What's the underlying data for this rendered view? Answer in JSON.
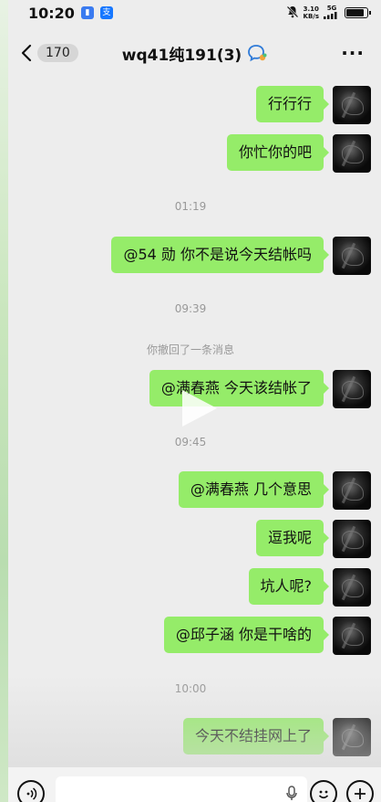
{
  "status_bar": {
    "time": "10:20",
    "net_speed_value": "3.10",
    "net_speed_unit": "KB/s",
    "network": "5G",
    "battery_level": 0.85
  },
  "header": {
    "back_count": "170",
    "title": "wq41纯191(3)",
    "more_label": "···"
  },
  "messages": [
    {
      "type": "outgoing",
      "text": "行行行"
    },
    {
      "type": "outgoing",
      "text": "你忙你的吧"
    },
    {
      "type": "time",
      "text": "01:19"
    },
    {
      "type": "outgoing",
      "text": "@54 勋  你不是说今天结帐吗"
    },
    {
      "type": "time",
      "text": "09:39"
    },
    {
      "type": "system",
      "text": "你撤回了一条消息"
    },
    {
      "type": "outgoing",
      "text": "@满春燕  今天该结帐了"
    },
    {
      "type": "time",
      "text": "09:45"
    },
    {
      "type": "outgoing",
      "text": "@满春燕  几个意思"
    },
    {
      "type": "outgoing",
      "text": "逗我呢"
    },
    {
      "type": "outgoing",
      "text": "坑人呢?"
    },
    {
      "type": "outgoing",
      "text": "@邱子涵  你是干啥的"
    },
    {
      "type": "time",
      "text": "10:00"
    },
    {
      "type": "outgoing",
      "text": "今天不结挂网上了"
    }
  ],
  "colors": {
    "bubble": "#95ec69",
    "background": "#ededed",
    "timestamp": "#999999"
  },
  "icons": {
    "back": "chevron-left-icon",
    "group_badge": "chat-bubble-badge-icon",
    "voice": "voice-icon",
    "mic": "mic-icon",
    "emoji": "emoji-icon",
    "plus": "plus-icon",
    "play": "play-icon"
  }
}
